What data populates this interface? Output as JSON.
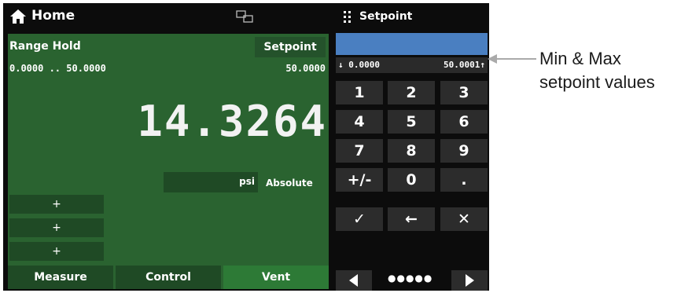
{
  "header": {
    "title": "Home",
    "panel_title": "Setpoint"
  },
  "left": {
    "range_hold_label": "Range Hold",
    "setpoint_button": "Setpoint",
    "range_values": "0.0000 .. 50.0000",
    "setpoint_value": "50.0000",
    "reading": "14.3264",
    "unit": "psi",
    "mode": "Absolute",
    "plus_buttons": [
      "+",
      "+",
      "+"
    ],
    "tabs": [
      "Measure",
      "Control",
      "Vent"
    ]
  },
  "keypad": {
    "min_value": "↓ 0.0000",
    "max_value": "50.0001↑",
    "keys": [
      "1",
      "2",
      "3",
      "4",
      "5",
      "6",
      "7",
      "8",
      "9",
      "+/-",
      "0",
      ".",
      "✓",
      "←",
      "✕"
    ],
    "page_dots": "●●●●●"
  },
  "annotation": {
    "line1": "Min & Max",
    "line2": "setpoint values"
  },
  "colors": {
    "background": "#0c0c0c",
    "panel_green": "#2a6330",
    "entry_blue": "#4a7fc1"
  },
  "icons": [
    "home-icon",
    "network-icon",
    "grip-icon",
    "prev-icon",
    "next-icon"
  ]
}
